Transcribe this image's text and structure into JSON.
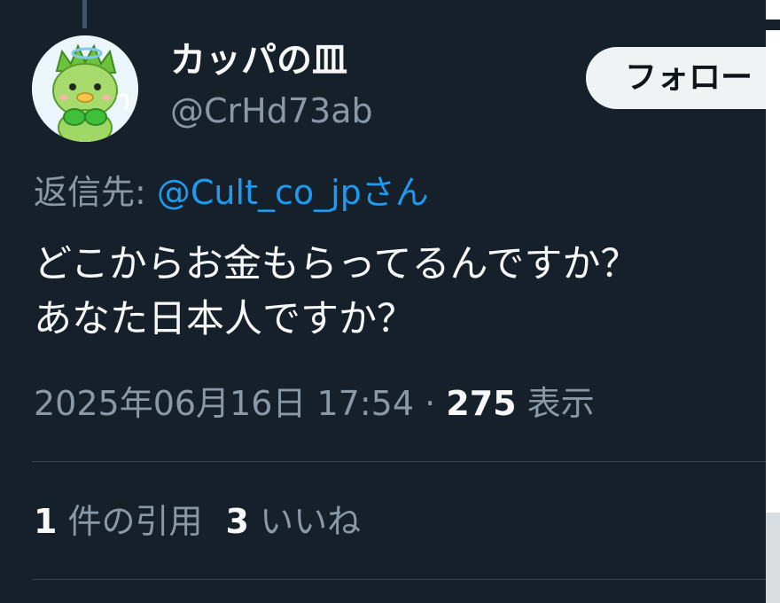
{
  "tweet": {
    "author": {
      "display_name": "カッパの皿",
      "handle": "@CrHd73ab",
      "avatar_icon": "kappa-avatar-icon"
    },
    "follow_label": "フォロー",
    "reply_to": {
      "prefix": "返信先: ",
      "mention": "@Cult_co_jpさん"
    },
    "body_lines": [
      "どこからお金もらってるんですか？",
      "あなた日本人ですか？"
    ],
    "meta": {
      "timestamp": "2025年06月16日 17:54",
      "separator": " · ",
      "views_count": "275",
      "views_label": " 表示"
    },
    "stats": {
      "quotes_count": "1",
      "quotes_label": " 件の引用",
      "likes_count": "3",
      "likes_label": " いいね"
    }
  },
  "colors": {
    "background": "#15202b",
    "text_primary": "#f7f9f9",
    "text_secondary": "#8b98a5",
    "link": "#1d9bf0",
    "divider": "#38444d",
    "follow_button_bg": "#eff3f4"
  }
}
